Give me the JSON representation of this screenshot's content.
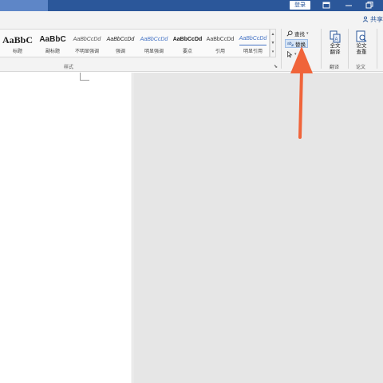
{
  "titlebar": {
    "login_label": "登录",
    "icons": [
      "ribbon-display-options-icon",
      "minimize-icon",
      "restore-icon"
    ]
  },
  "tabrow": {
    "share_label": "共享"
  },
  "styles": {
    "items": [
      {
        "sample": "AaBbC",
        "name": "标题"
      },
      {
        "sample": "AaBbC",
        "name": "副标题"
      },
      {
        "sample": "AaBbCcDd",
        "name": "不明显强调"
      },
      {
        "sample": "AaBbCcDd",
        "name": "强调"
      },
      {
        "sample": "AaBbCcDd",
        "name": "明显强调"
      },
      {
        "sample": "AaBbCcDd",
        "name": "要点"
      },
      {
        "sample": "AaBbCcDd",
        "name": "引用"
      },
      {
        "sample": "AaBbCcDd",
        "name": "明显引用"
      }
    ],
    "group_label": "样式"
  },
  "editing": {
    "find_label": "查找",
    "replace_label": "替换",
    "select_icon": "cursor-select-icon"
  },
  "translate": {
    "button_label_1": "全文",
    "button_label_2": "翻译",
    "group_label": "翻译"
  },
  "paper": {
    "button_label_1": "论文",
    "button_label_2": "查重",
    "group_label": "论文"
  },
  "colors": {
    "titlebar": "#2b579a",
    "accent_arrow": "#f0643a"
  }
}
